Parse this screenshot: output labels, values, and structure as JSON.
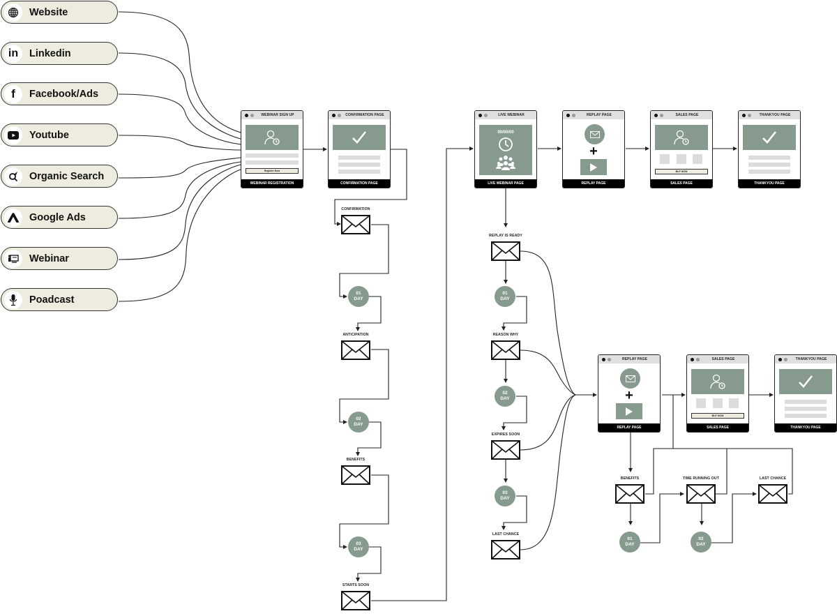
{
  "colors": {
    "accent_sage": "#869a8e",
    "source_fill": "#eeecdf",
    "line": "#222222",
    "footer": "#000000"
  },
  "sources": [
    {
      "label": "Website",
      "icon": "globe-icon"
    },
    {
      "label": "Linkedin",
      "icon": "linkedin-icon"
    },
    {
      "label": "Facebook/Ads",
      "icon": "facebook-icon"
    },
    {
      "label": "Youtube",
      "icon": "youtube-icon"
    },
    {
      "label": "Organic Search",
      "icon": "search-icon"
    },
    {
      "label": "Google Ads",
      "icon": "google-ads-icon"
    },
    {
      "label": "Webinar",
      "icon": "webinar-icon"
    },
    {
      "label": "Poadcast",
      "icon": "microphone-icon"
    }
  ],
  "pages": {
    "signup": {
      "title": "WEBINAR SIGN UP",
      "footer": "WEBINAR REGISTRATION",
      "cta": "Register Now"
    },
    "confirmation": {
      "title": "CONFIRMATION PAGE",
      "footer": "CONFIRMATION PAGE"
    },
    "live": {
      "title": "LIVE WEBINAR",
      "footer": "LIVE WEBINAR PAGE",
      "timer": "00/00/00"
    },
    "replay1": {
      "title": "REPLAY PAGE",
      "footer": "REPLAY PAGE"
    },
    "sales1": {
      "title": "SALES PAGE",
      "footer": "SALES PAGE",
      "cta": "BUY NOW"
    },
    "thanks1": {
      "title": "THANKYOU PAGE",
      "footer": "THANKYOU PAGE"
    },
    "replay2": {
      "title": "REPLAY PAGE",
      "footer": "REPLAY PAGE"
    },
    "sales2": {
      "title": "SALES PAGE",
      "footer": "SALES PAGE",
      "cta": "BUY NOW"
    },
    "thanks2": {
      "title": "THANKYOU PAGE",
      "footer": "THANKYOU PAGE"
    }
  },
  "pre_webinar_sequence": {
    "emails": [
      "CONFIRMATION",
      "ANTICIPATION",
      "BENEFITS",
      "STARTS SOON"
    ],
    "delays": [
      {
        "num": "01",
        "unit": "DAY"
      },
      {
        "num": "02",
        "unit": "DAY"
      },
      {
        "num": "03",
        "unit": "DAY"
      }
    ]
  },
  "replay_sequence": {
    "emails": [
      "REPLAY IS READY",
      "REASON WHY",
      "EXPIRES SOON",
      "LAST CHANCE"
    ],
    "delays": [
      {
        "num": "01",
        "unit": "DAY"
      },
      {
        "num": "02",
        "unit": "DAY"
      },
      {
        "num": "03",
        "unit": "DAY"
      }
    ]
  },
  "sales_sequence": {
    "emails": [
      "BENEFITS",
      "TIME RUNNING OUT",
      "LAST CHANCE"
    ],
    "delays": [
      {
        "num": "01",
        "unit": "DAY"
      },
      {
        "num": "02",
        "unit": "DAY"
      }
    ]
  }
}
